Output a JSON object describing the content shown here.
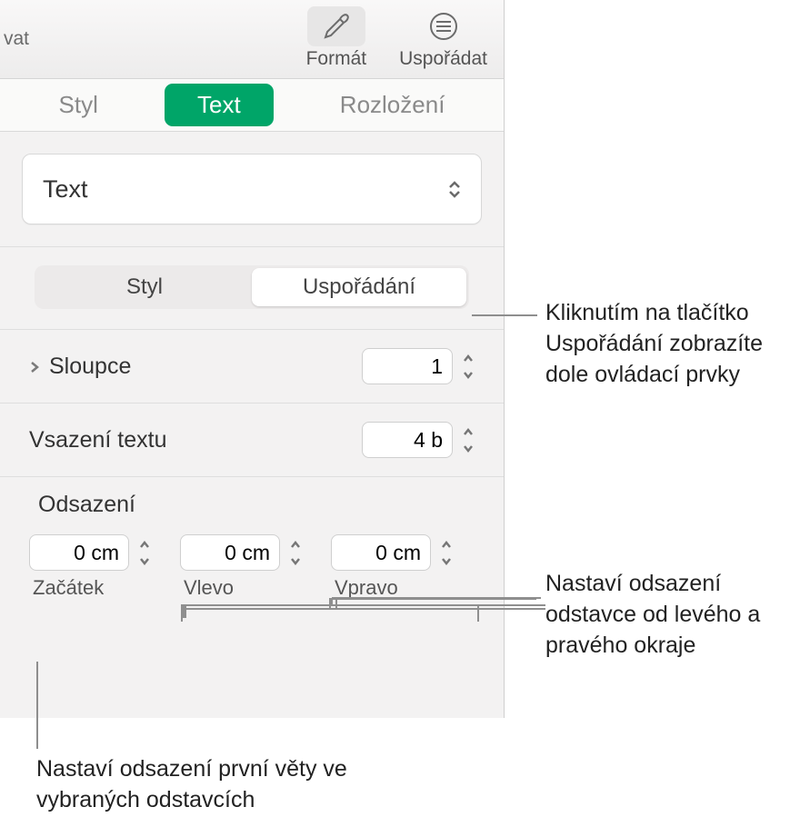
{
  "toolbar": {
    "left_cut_text": "vat",
    "buttons": [
      {
        "label": "Formát",
        "active": true
      },
      {
        "label": "Uspořádat",
        "active": false
      }
    ]
  },
  "main_tabs": [
    {
      "label": "Styl",
      "active": false
    },
    {
      "label": "Text",
      "active": true
    },
    {
      "label": "Rozložení",
      "active": false
    }
  ],
  "dropdown": {
    "value": "Text"
  },
  "segmented": [
    {
      "label": "Styl",
      "active": false
    },
    {
      "label": "Uspořádání",
      "active": true
    }
  ],
  "rows": {
    "columns": {
      "label": "Sloupce",
      "value": "1"
    },
    "text_inset": {
      "label": "Vsazení textu",
      "value": "4 b"
    }
  },
  "indent": {
    "header": "Odsazení",
    "fields": [
      {
        "value": "0 cm",
        "label": "Začátek"
      },
      {
        "value": "0 cm",
        "label": "Vlevo"
      },
      {
        "value": "0 cm",
        "label": "Vpravo"
      }
    ]
  },
  "callouts": {
    "layout_btn": "Kliknutím na tlačítko Uspořádání zobrazíte dole ovládací prvky",
    "margins": "Nastaví odsazení odstavce od levého a pravého okraje",
    "first_line": "Nastaví odsazení první věty ve vybraných odstavcích"
  }
}
